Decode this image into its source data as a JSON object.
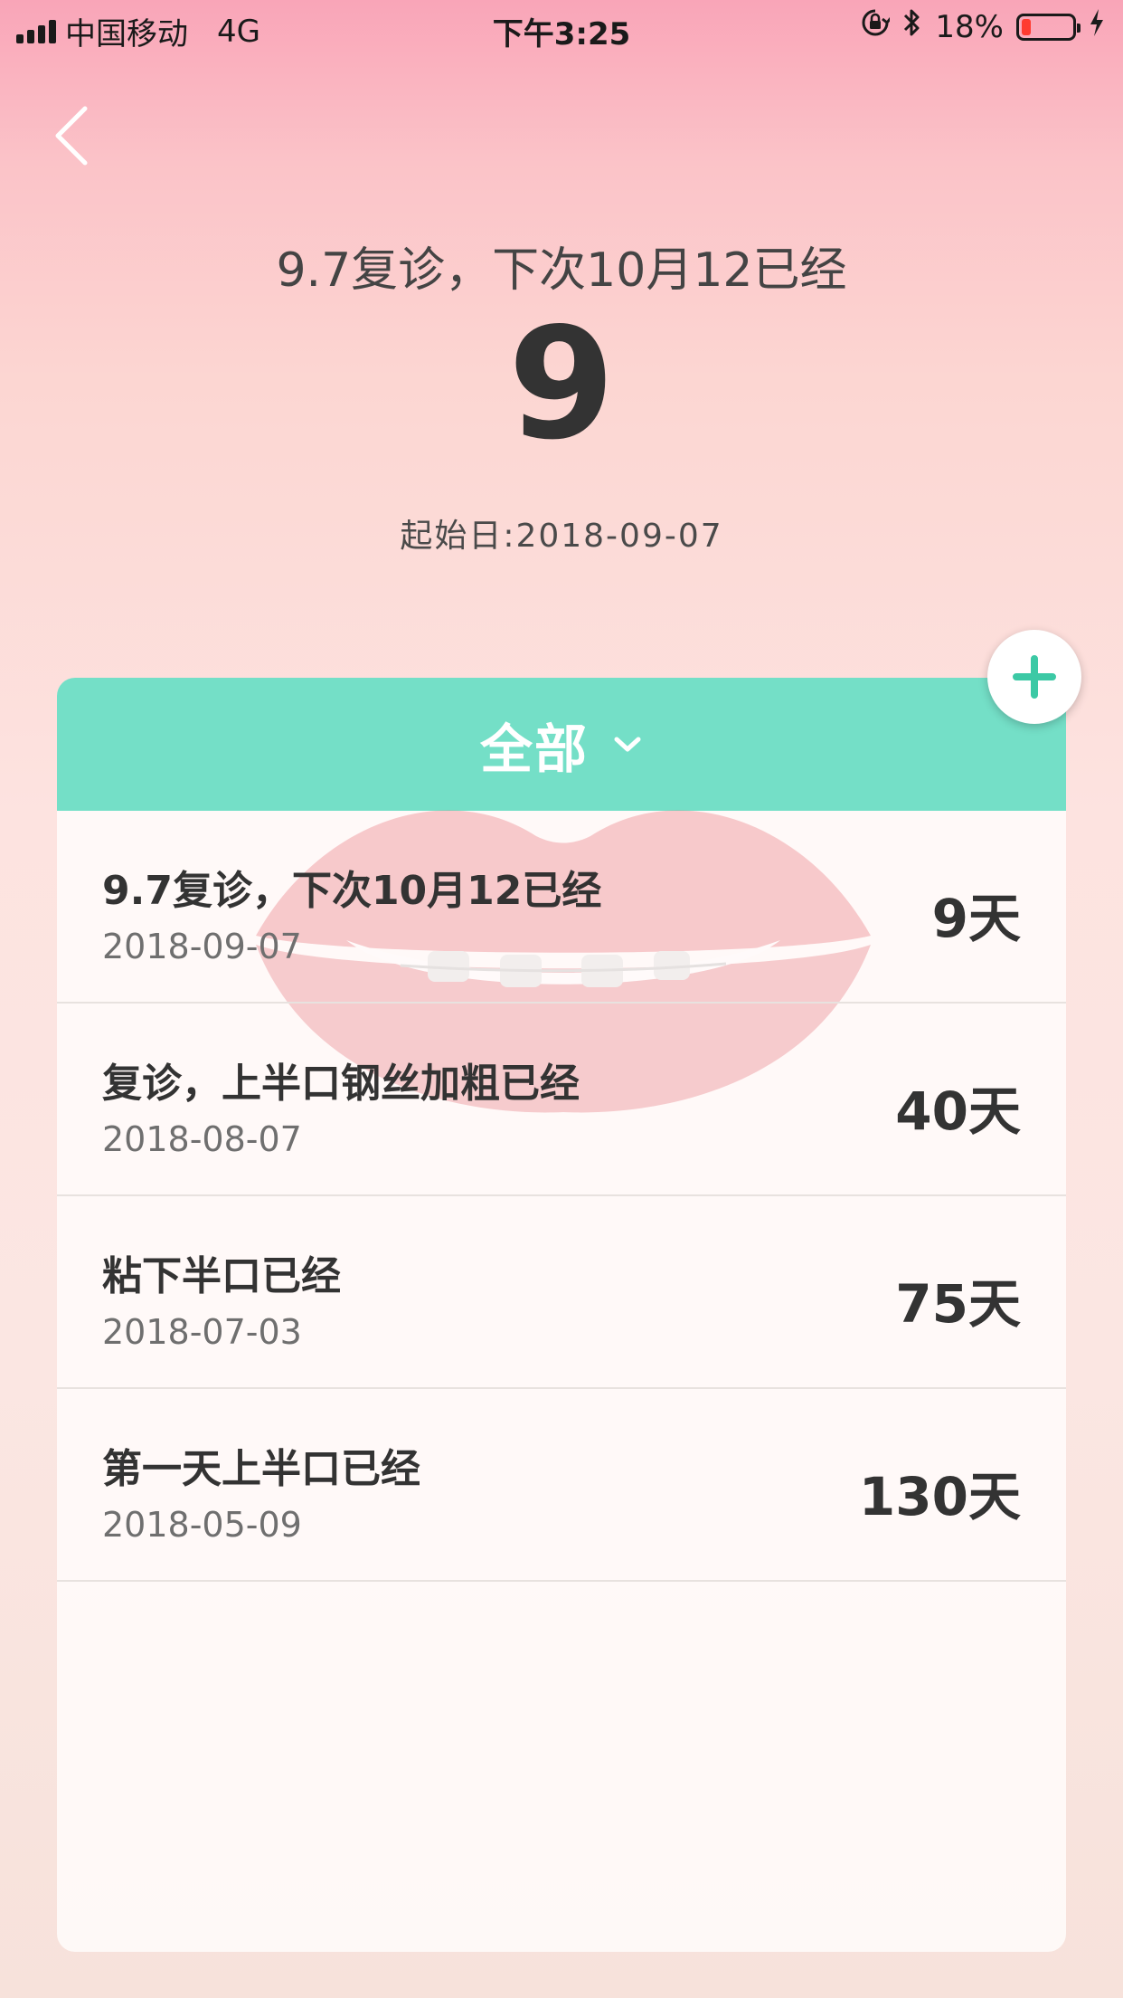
{
  "status_bar": {
    "carrier": "中国移动",
    "network": "4G",
    "time": "下午3:25",
    "battery_percent": "18%",
    "battery_level": 0.18,
    "battery_color": "#ff3b30"
  },
  "header": {
    "title": "9.7复诊，下次10月12已经",
    "count": "9",
    "start_date": "起始日:2018-09-07"
  },
  "filter": {
    "label": "全部",
    "accent_color": "#74dfc7"
  },
  "fab": {
    "icon": "plus-icon",
    "color": "#3cc9a5"
  },
  "items": [
    {
      "title": "9.7复诊，下次10月12已经",
      "date": "2018-09-07",
      "days": "9天"
    },
    {
      "title": "复诊，上半口钢丝加粗已经",
      "date": "2018-08-07",
      "days": "40天"
    },
    {
      "title": "粘下半口已经",
      "date": "2018-07-03",
      "days": "75天"
    },
    {
      "title": "第一天上半口已经",
      "date": "2018-05-09",
      "days": "130天"
    }
  ]
}
